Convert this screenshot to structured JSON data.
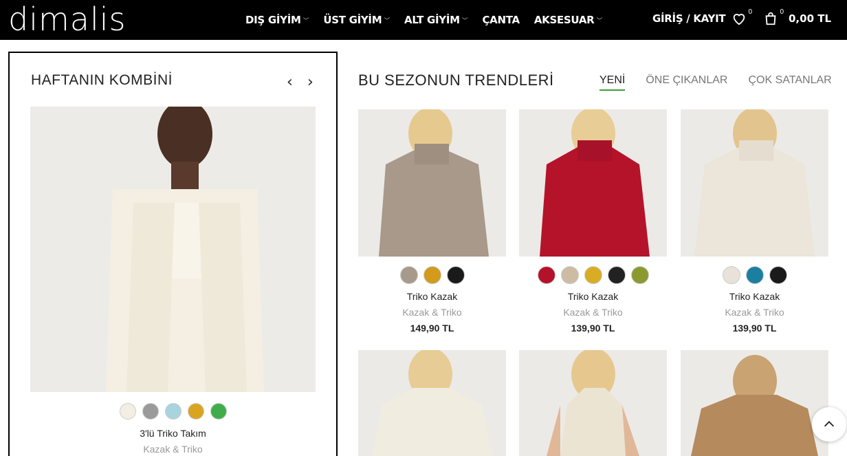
{
  "header": {
    "logo": "dimalis",
    "nav": [
      "DIŞ GİYİM",
      "ÜST GİYİM",
      "ALT GİYİM",
      "ÇANTA",
      "AKSESUAR"
    ],
    "login": "GİRİŞ / KAYIT",
    "wishlist_count": "0",
    "cart_count": "0",
    "cart_total": "0,00 TL"
  },
  "combo": {
    "title": "HAFTANIN KOMBİNİ",
    "product_name": "3'lü Triko Takım",
    "product_category": "Kazak & Triko",
    "swatches": [
      "#f3eee2",
      "#9a9a9a",
      "#a8d4de",
      "#d9a520",
      "#3fae4a"
    ]
  },
  "trends": {
    "title": "BU SEZONUN TRENDLERİ",
    "tabs": [
      "YENİ",
      "ÖNE ÇIKANLAR",
      "ÇOK SATANLAR"
    ],
    "products": [
      {
        "name": "Triko Kazak",
        "category": "Kazak & Triko",
        "price": "149,90 TL",
        "swatches": [
          "#a89a8a",
          "#d39a1c",
          "#1a1a1a"
        ]
      },
      {
        "name": "Triko Kazak",
        "category": "Kazak & Triko",
        "price": "139,90 TL",
        "swatches": [
          "#b3122a",
          "#cdbba4",
          "#d9ac26",
          "#222222",
          "#8b9a2e"
        ]
      },
      {
        "name": "Triko Kazak",
        "category": "Kazak & Triko",
        "price": "139,90 TL",
        "swatches": [
          "#e8e2d8",
          "#1b7fa0",
          "#1a1a1a"
        ]
      },
      {
        "name": "",
        "category": "",
        "price": "",
        "swatches": []
      },
      {
        "name": "",
        "category": "",
        "price": "",
        "swatches": []
      },
      {
        "name": "",
        "category": "",
        "price": "",
        "swatches": []
      }
    ]
  },
  "colors": {
    "header_bg": "#000000",
    "tab_active": "#3a9e3a"
  }
}
